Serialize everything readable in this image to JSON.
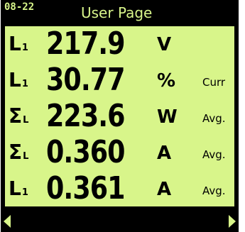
{
  "header": {
    "date": "08-22",
    "title": "User Page"
  },
  "readings": [
    {
      "phase": "L",
      "phase_sub": "1",
      "value": "217.9",
      "unit": "V",
      "tag": ""
    },
    {
      "phase": "L",
      "phase_sub": "1",
      "value": "30.77",
      "unit": "%",
      "tag": "Curr"
    },
    {
      "phase": "Σ",
      "phase_sub": "L",
      "value": "223.6",
      "unit": "W",
      "tag": "Avg."
    },
    {
      "phase": "Σ",
      "phase_sub": "L",
      "value": "0.360",
      "unit": "A",
      "tag": "Avg."
    },
    {
      "phase": "L",
      "phase_sub": "1",
      "value": "0.361",
      "unit": "A",
      "tag": "Avg."
    }
  ],
  "nav": {
    "left_icon": "arrow-left-icon",
    "right_icon": "arrow-right-icon"
  },
  "colors": {
    "screen_background": "#d8f58a",
    "frame": "#000000",
    "text": "#000000"
  }
}
